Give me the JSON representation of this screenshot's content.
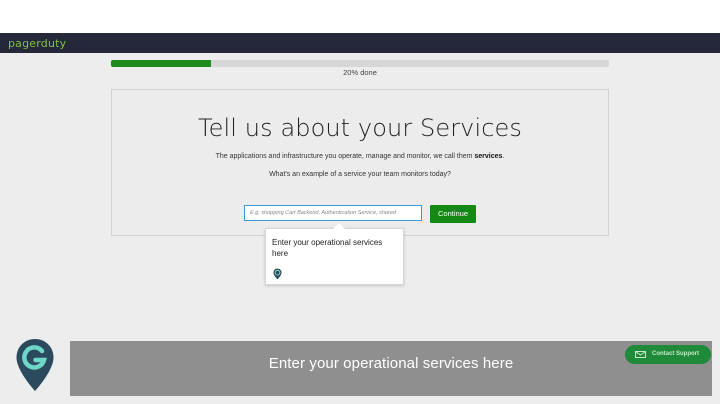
{
  "header": {
    "logo_text": "pagerduty"
  },
  "progress": {
    "value": 0.2,
    "label": "20% done"
  },
  "card": {
    "title": "Tell us about your Services",
    "description_prefix": "The applications and infrastructure you operate, manage and monitor, we call them ",
    "description_bold": "services",
    "description_suffix": ".",
    "question": "What's an example of a service your team monitors today?",
    "input_placeholder": "E.g. shopping Cart Backend, Authentication Service, shared",
    "continue_label": "Continue"
  },
  "tooltip": {
    "text": "Enter your operational services here"
  },
  "caption": {
    "text": "Enter your operational services here"
  },
  "support": {
    "label": "Contact Support"
  },
  "colors": {
    "accent_green": "#148a14",
    "nav_bg": "#252839",
    "logo_green": "#7fc241",
    "pin_blue": "#2b4a5e"
  },
  "icons": {
    "tooltip_icon": "guide-pin-icon",
    "support_icon": "envelope-icon",
    "brand_icon": "guide-pin-logo-icon"
  }
}
